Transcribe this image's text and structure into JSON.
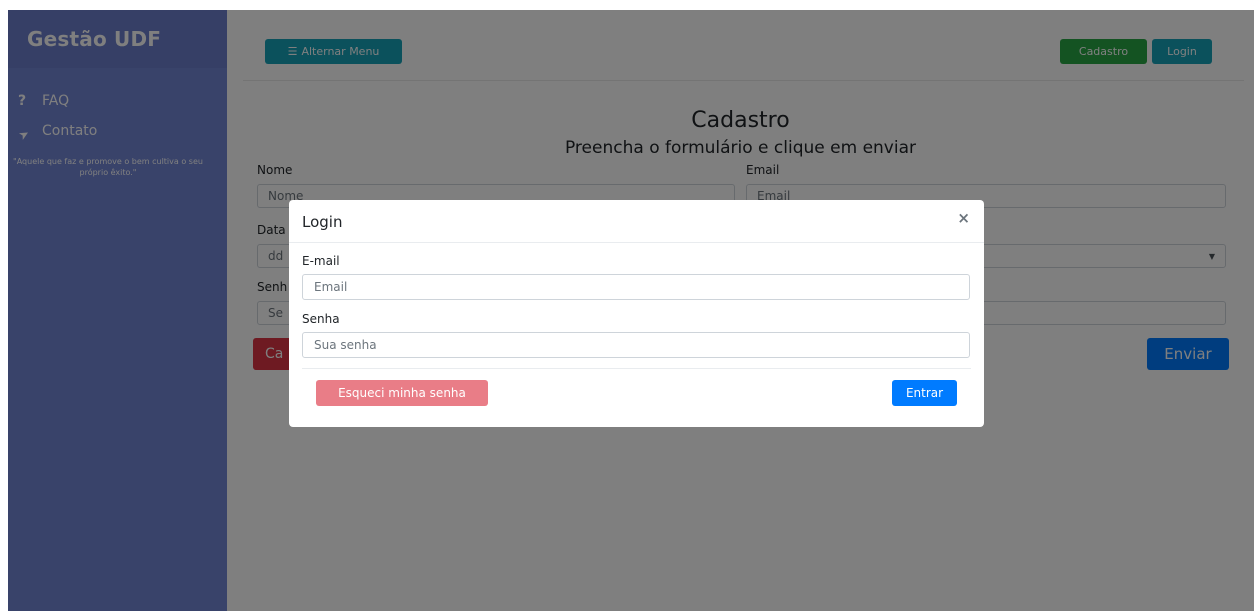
{
  "sidebar": {
    "title": "Gestão UDF",
    "items": [
      {
        "icon": "question-icon",
        "glyph": "?",
        "label": "FAQ"
      },
      {
        "icon": "paper-plane-icon",
        "glyph": "➤",
        "label": "Contato"
      }
    ],
    "quote": "\"Aquele que faz e promove o bem cultiva o seu próprio êxito.\""
  },
  "topbar": {
    "toggle_label": "Alternar Menu",
    "cadastro_label": "Cadastro",
    "login_label": "Login"
  },
  "form": {
    "title": "Cadastro",
    "subtitle": "Preencha o formulário e clique em enviar",
    "name_label": "Nome",
    "name_placeholder": "Nome",
    "email_label": "Email",
    "email_placeholder": "Email",
    "date_label": "Data",
    "date_placeholder": "dd",
    "password_label": "Senh",
    "password_placeholder": "Se",
    "cancel_label": "Ca",
    "submit_label": "Enviar"
  },
  "modal": {
    "title": "Login",
    "close_glyph": "×",
    "email_label": "E-mail",
    "email_placeholder": "Email",
    "password_label": "Senha",
    "password_placeholder": "Sua senha",
    "forgot_label": "Esqueci minha senha",
    "enter_label": "Entrar"
  },
  "colors": {
    "sidebar": "#7386d5",
    "info": "#17a2b8",
    "success": "#28a745",
    "danger": "#dc3545",
    "primary": "#007bff"
  }
}
